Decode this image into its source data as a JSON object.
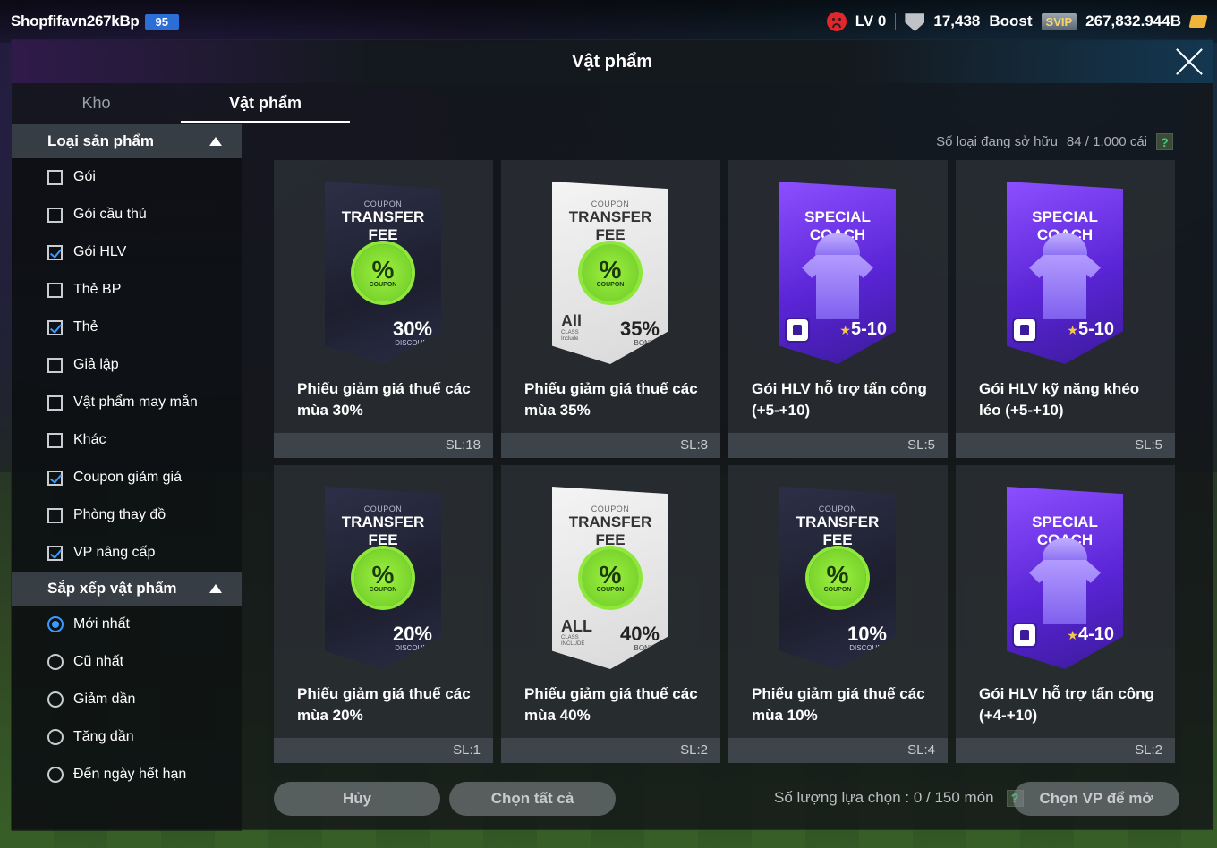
{
  "topbar": {
    "user_name": "Shopfifavn267kBp",
    "user_level": "95",
    "lv": "LV 0",
    "shield_value": "17,438",
    "boost_label": "Boost",
    "svip_label": "SVIP",
    "bp_value": "267,832.944B"
  },
  "modal": {
    "title": "Vật phẩm",
    "tabs": [
      {
        "label": "Kho"
      },
      {
        "label": "Vật phẩm"
      }
    ]
  },
  "sidebar": {
    "product_type_label": "Loại sản phẩm",
    "filters": [
      {
        "label": "Gói",
        "checked": false
      },
      {
        "label": "Gói cầu thủ",
        "checked": false
      },
      {
        "label": "Gói HLV",
        "checked": true
      },
      {
        "label": "Thẻ BP",
        "checked": false
      },
      {
        "label": "Thẻ",
        "checked": true
      },
      {
        "label": "Giả lập",
        "checked": false
      },
      {
        "label": "Vật phẩm may mắn",
        "checked": false
      },
      {
        "label": "Khác",
        "checked": false
      },
      {
        "label": "Coupon giảm giá",
        "checked": true
      },
      {
        "label": "Phòng thay đồ",
        "checked": false
      },
      {
        "label": "VP nâng cấp",
        "checked": true
      }
    ],
    "sort_label": "Sắp xếp vật phẩm",
    "sorts": [
      {
        "label": "Mới nhất",
        "selected": true
      },
      {
        "label": "Cũ nhất",
        "selected": false
      },
      {
        "label": "Giảm dần",
        "selected": false
      },
      {
        "label": "Tăng dần",
        "selected": false
      },
      {
        "label": "Đến ngày hết hạn",
        "selected": false
      }
    ]
  },
  "owned": {
    "label": "Số loại đang sở hữu",
    "value": "84 / 1.000 cái",
    "help": "?"
  },
  "cards": [
    {
      "art": "coupon",
      "style": "dark",
      "small": "COUPON",
      "title": "TRANSFER FEE",
      "value": "30%",
      "sub": "DISCOUNT",
      "all": "",
      "all_sub": "",
      "name": "Phiếu giảm giá thuế các mùa 30%",
      "qty": "SL:18"
    },
    {
      "art": "coupon",
      "style": "white",
      "small": "COUPON",
      "title": "TRANSFER FEE",
      "value": "35%",
      "sub": "BONUS",
      "all": "All",
      "all_sub": "CLASS Include",
      "name": "Phiếu giảm giá thuế các mùa 35%",
      "qty": "SL:8"
    },
    {
      "art": "coach",
      "title": "SPECIAL COACH",
      "range": "5-10",
      "name": "Gói HLV hỗ trợ tấn công (+5-+10)",
      "qty": "SL:5"
    },
    {
      "art": "coach",
      "title": "SPECIAL COACH",
      "range": "5-10",
      "name": "Gói HLV kỹ năng khéo léo (+5-+10)",
      "qty": "SL:5"
    },
    {
      "art": "coupon",
      "style": "dark",
      "small": "COUPON",
      "title": "TRANSFER FEE",
      "value": "20%",
      "sub": "DISCOUNT",
      "all": "",
      "all_sub": "",
      "name": "Phiếu giảm giá thuế các mùa 20%",
      "qty": "SL:1"
    },
    {
      "art": "coupon",
      "style": "white",
      "small": "COUPON",
      "title": "TRANSFER FEE",
      "value": "40%",
      "sub": "BONUS",
      "all": "ALL",
      "all_sub": "CLASS INCLUDE",
      "name": "Phiếu giảm giá thuế các mùa 40%",
      "qty": "SL:2"
    },
    {
      "art": "coupon",
      "style": "dark",
      "small": "COUPON",
      "title": "TRANSFER FEE",
      "value": "10%",
      "sub": "DISCOUNT",
      "all": "",
      "all_sub": "",
      "name": "Phiếu giảm giá thuế các mùa 10%",
      "qty": "SL:4"
    },
    {
      "art": "coach",
      "title": "SPECIAL COACH",
      "range": "4-10",
      "name": "Gói HLV hỗ trợ tấn công (+4-+10)",
      "qty": "SL:2"
    }
  ],
  "footer": {
    "cancel_label": "Hủy",
    "select_all_label": "Chọn tất cả",
    "selection_label": "Số lượng lựa chọn : 0 / 150 món",
    "open_label": "Chọn VP để mở",
    "help": "?"
  },
  "colors": {
    "accent_blue": "#3a9bff",
    "badge_blue": "#2b6fd6",
    "coupon_green": "#8ee83a",
    "coach_purple": "#5a25d6"
  }
}
